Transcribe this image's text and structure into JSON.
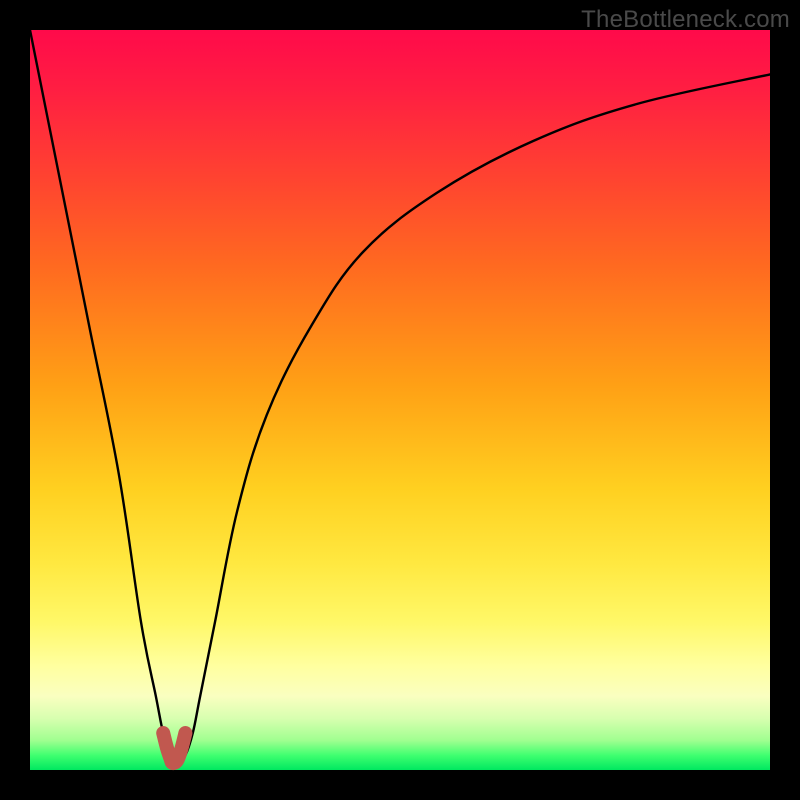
{
  "watermark": "TheBottleneck.com",
  "colors": {
    "frame": "#000000",
    "curve": "#000000",
    "marker": "#c1584f"
  },
  "chart_data": {
    "type": "line",
    "title": "",
    "xlabel": "",
    "ylabel": "",
    "xlim": [
      0,
      100
    ],
    "ylim": [
      0,
      100
    ],
    "grid": false,
    "legend": false,
    "series": [
      {
        "name": "bottleneck-curve",
        "x": [
          0,
          4,
          8,
          12,
          15,
          17,
          18,
          19,
          20,
          21,
          22,
          23,
          25,
          28,
          32,
          38,
          45,
          55,
          68,
          82,
          100
        ],
        "values": [
          100,
          80,
          60,
          40,
          20,
          10,
          5,
          2,
          1,
          2,
          5,
          10,
          20,
          35,
          48,
          60,
          70,
          78,
          85,
          90,
          94
        ]
      }
    ],
    "marker": {
      "name": "optimal-range",
      "x": [
        18,
        18.5,
        19,
        19.2,
        19.6,
        20,
        20.5,
        21
      ],
      "values": [
        5,
        3,
        1.5,
        1,
        1,
        1.5,
        3,
        5
      ]
    },
    "gradient_stops": [
      {
        "pos": 0.0,
        "color": "#ff0a4a"
      },
      {
        "pos": 0.2,
        "color": "#ff4330"
      },
      {
        "pos": 0.48,
        "color": "#ffa015"
      },
      {
        "pos": 0.72,
        "color": "#ffe840"
      },
      {
        "pos": 0.9,
        "color": "#faffc0"
      },
      {
        "pos": 1.0,
        "color": "#00e860"
      }
    ]
  }
}
